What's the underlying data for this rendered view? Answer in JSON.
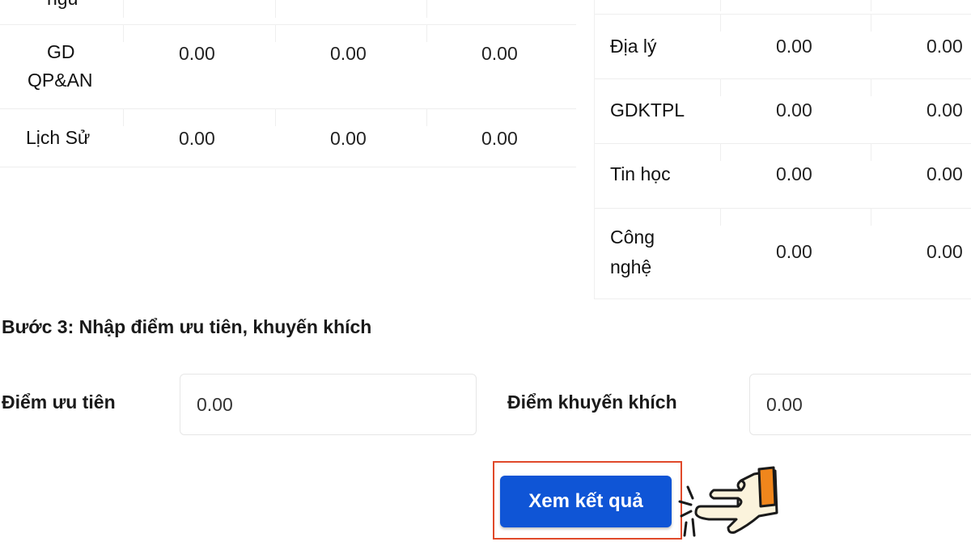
{
  "left_table": {
    "top_clipped_subject": "ngữ",
    "rows": [
      {
        "subject_line1": "GD",
        "subject_line2": "QP&AN",
        "scores": [
          "0.00",
          "0.00",
          "0.00"
        ]
      },
      {
        "subject": "Lịch Sử",
        "scores": [
          "0.00",
          "0.00",
          "0.00"
        ]
      }
    ]
  },
  "right_table": {
    "rows": [
      {
        "subject": "Địa lý",
        "scores": [
          "0.00",
          "0.00"
        ]
      },
      {
        "subject": "GDKTPL",
        "scores": [
          "0.00",
          "0.00"
        ]
      },
      {
        "subject": "Tin học",
        "scores": [
          "0.00",
          "0.00"
        ]
      },
      {
        "subject_line1": "Công",
        "subject_line2": "nghệ",
        "scores": [
          "0.00",
          "0.00"
        ]
      }
    ]
  },
  "step3": {
    "title": "Bước 3: Nhập điểm ưu tiên, khuyến khích",
    "priority": {
      "label": "Điểm ưu tiên",
      "value": "0.00"
    },
    "encouragement": {
      "label": "Điểm khuyến khích",
      "value": "0.00"
    }
  },
  "result_button": {
    "label": "Xem kết quả"
  },
  "colors": {
    "button": "#0f55d6",
    "highlight": "#e0492a",
    "hand_cuff": "#f0861c"
  },
  "icons": {
    "pointer": "pointing-hand-icon"
  }
}
